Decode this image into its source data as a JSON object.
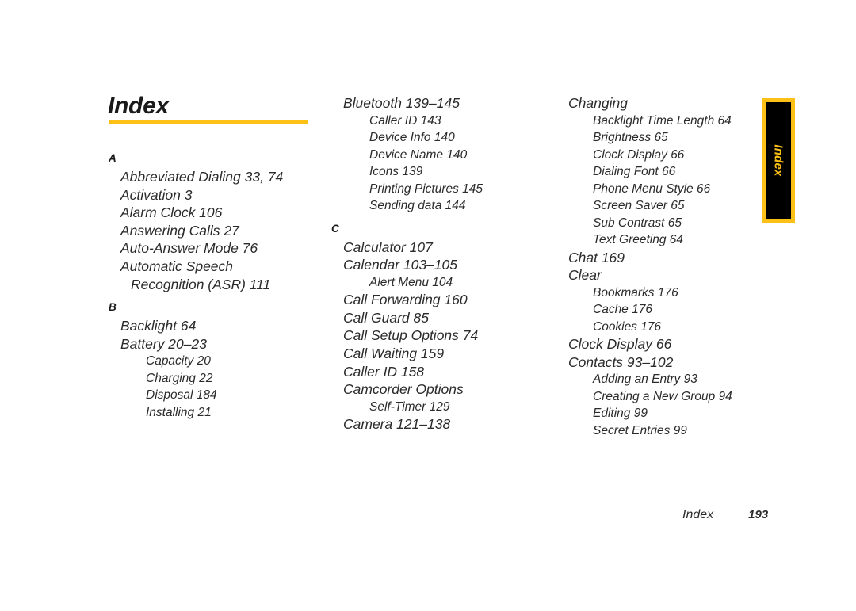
{
  "page": {
    "title": "Index",
    "footer_label": "Index",
    "footer_page": "193",
    "side_tab_label": "Index",
    "accent_color": "#fcc016",
    "tab_background": "#000000"
  },
  "columns": [
    {
      "name": "column-1",
      "blocks": [
        {
          "letter": "A",
          "entries": [
            {
              "level": 1,
              "text": "Abbreviated Dialing 33, 74"
            },
            {
              "level": 1,
              "text": "Activation 3"
            },
            {
              "level": 1,
              "text": "Alarm Clock 106"
            },
            {
              "level": 1,
              "text": "Answering Calls 27"
            },
            {
              "level": 1,
              "text": "Auto-Answer Mode 76"
            },
            {
              "level": 1,
              "text": "Automatic Speech"
            },
            {
              "level": "1w",
              "text": "Recognition (ASR) 111"
            }
          ]
        },
        {
          "letter": "B",
          "entries": [
            {
              "level": 1,
              "text": "Backlight 64"
            },
            {
              "level": 1,
              "text": "Battery 20–23"
            },
            {
              "level": 2,
              "text": "Capacity 20"
            },
            {
              "level": 2,
              "text": "Charging 22"
            },
            {
              "level": 2,
              "text": "Disposal 184"
            },
            {
              "level": 2,
              "text": "Installing 21"
            }
          ]
        }
      ]
    },
    {
      "name": "column-2",
      "blocks": [
        {
          "letter": "",
          "entries": [
            {
              "level": 1,
              "text": "Bluetooth 139–145"
            },
            {
              "level": 2,
              "text": "Caller ID 143"
            },
            {
              "level": 2,
              "text": "Device Info 140"
            },
            {
              "level": 2,
              "text": "Device Name 140"
            },
            {
              "level": 2,
              "text": "Icons 139"
            },
            {
              "level": 2,
              "text": "Printing Pictures 145"
            },
            {
              "level": 2,
              "text": "Sending data 144"
            }
          ]
        },
        {
          "letter": "C",
          "entries": [
            {
              "level": 1,
              "text": "Calculator 107"
            },
            {
              "level": 1,
              "text": "Calendar 103–105"
            },
            {
              "level": 2,
              "text": "Alert Menu 104"
            },
            {
              "level": 1,
              "text": "Call Forwarding 160"
            },
            {
              "level": 1,
              "text": "Call Guard 85"
            },
            {
              "level": 1,
              "text": "Call Setup Options 74"
            },
            {
              "level": 1,
              "text": "Call Waiting 159"
            },
            {
              "level": 1,
              "text": "Caller ID 158"
            },
            {
              "level": 1,
              "text": "Camcorder Options"
            },
            {
              "level": 2,
              "text": "Self-Timer 129"
            },
            {
              "level": 1,
              "text": "Camera 121–138"
            }
          ]
        }
      ]
    },
    {
      "name": "column-3",
      "blocks": [
        {
          "letter": "",
          "entries": [
            {
              "level": 1,
              "text": "Changing"
            },
            {
              "level": 2,
              "text": "Backlight Time Length 64"
            },
            {
              "level": 2,
              "text": "Brightness 65"
            },
            {
              "level": 2,
              "text": "Clock Display 66"
            },
            {
              "level": 2,
              "text": "Dialing Font 66"
            },
            {
              "level": 2,
              "text": "Phone Menu Style 66"
            },
            {
              "level": 2,
              "text": "Screen Saver 65"
            },
            {
              "level": 2,
              "text": "Sub Contrast 65"
            },
            {
              "level": 2,
              "text": "Text Greeting 64"
            },
            {
              "level": 1,
              "text": "Chat 169"
            },
            {
              "level": 1,
              "text": "Clear"
            },
            {
              "level": 2,
              "text": "Bookmarks 176"
            },
            {
              "level": 2,
              "text": "Cache 176"
            },
            {
              "level": 2,
              "text": "Cookies 176"
            },
            {
              "level": 1,
              "text": "Clock Display 66"
            },
            {
              "level": 1,
              "text": "Contacts 93–102"
            },
            {
              "level": 2,
              "text": "Adding an Entry 93"
            },
            {
              "level": 2,
              "text": "Creating a New Group 94"
            },
            {
              "level": 2,
              "text": "Editing 99"
            },
            {
              "level": 2,
              "text": "Secret Entries 99"
            }
          ]
        }
      ]
    }
  ]
}
